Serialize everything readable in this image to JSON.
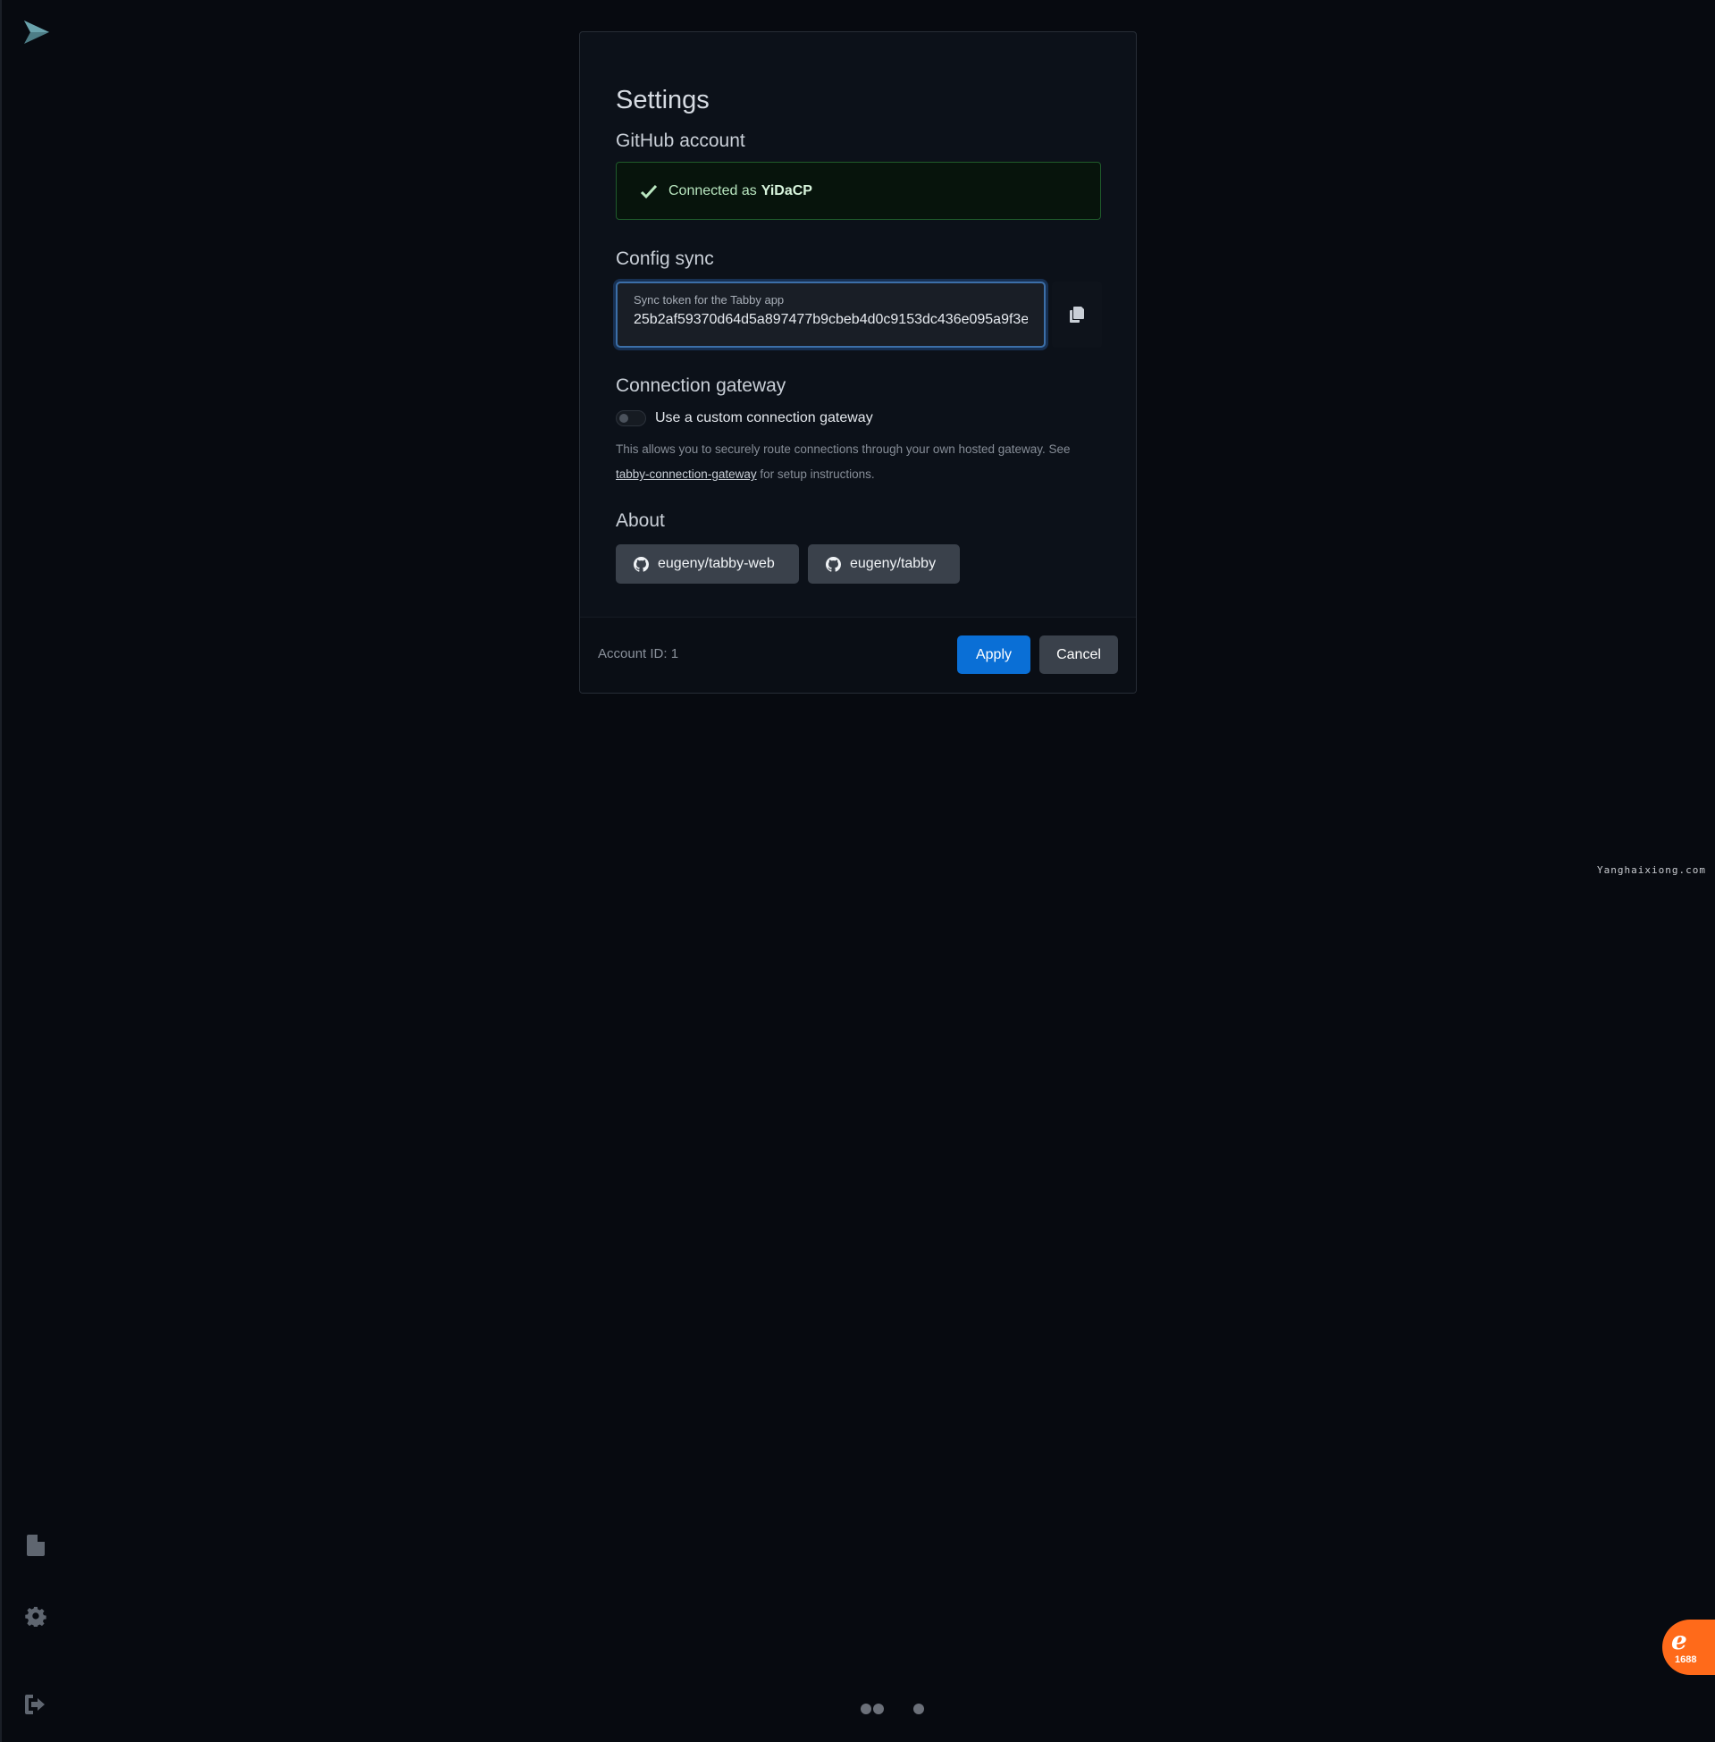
{
  "settings": {
    "title": "Settings",
    "github": {
      "section_title": "GitHub account",
      "connected_prefix": "Connected as",
      "username": "YiDaCP"
    },
    "config_sync": {
      "section_title": "Config sync",
      "token_label": "Sync token for the Tabby app",
      "token_value": "25b2af59370d64d5a897477b9cbeb4d0c9153dc436e095a9f3e"
    },
    "gateway": {
      "section_title": "Connection gateway",
      "toggle_label": "Use a custom connection gateway",
      "toggle_on": false,
      "help_text_before": "This allows you to securely route connections through your own hosted gateway. See",
      "help_link": "tabby-connection-gateway",
      "help_text_after": "for setup instructions."
    },
    "about": {
      "section_title": "About",
      "links": [
        {
          "label": "eugeny/tabby-web",
          "icon": "github-icon"
        },
        {
          "label": "eugeny/tabby",
          "icon": "github-icon"
        }
      ]
    },
    "footer": {
      "account_id": "Account ID: 1",
      "apply_label": "Apply",
      "cancel_label": "Cancel"
    }
  },
  "sidebar": {
    "icons": [
      "logo-icon",
      "file-icon",
      "gear-icon",
      "logout-icon"
    ]
  },
  "watermark": "Yanghaixiong.com",
  "badge": {
    "number": "1688"
  },
  "colors": {
    "background": "#070a10",
    "modal": "#0c1119",
    "apply_button": "#0a6fd6",
    "secondary_button": "#3a414b",
    "success_border": "#1f5b2b",
    "focus_border": "#3c6fa8"
  }
}
